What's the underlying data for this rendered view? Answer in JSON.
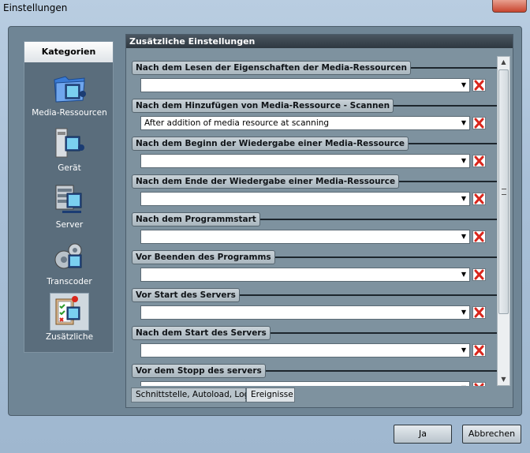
{
  "window": {
    "title": "Einstellungen"
  },
  "sidebar": {
    "header": "Kategorien",
    "items": [
      {
        "label": "Media-Ressourcen",
        "icon": "media-resources-icon"
      },
      {
        "label": "Gerät",
        "icon": "device-icon"
      },
      {
        "label": "Server",
        "icon": "server-icon"
      },
      {
        "label": "Transcoder",
        "icon": "transcoder-icon"
      },
      {
        "label": "Zusätzliche",
        "icon": "additional-icon"
      }
    ]
  },
  "main": {
    "header": "Zusätzliche Einstellungen",
    "groups": [
      {
        "title": "Nach dem Lesen der Eigenschaften der Media-Ressourcen",
        "value": ""
      },
      {
        "title": "Nach dem Hinzufügen von Media-Ressource - Scannen",
        "value": "After addition of media resource at scanning"
      },
      {
        "title": "Nach dem Beginn der Wiedergabe einer Media-Ressource",
        "value": ""
      },
      {
        "title": "Nach dem Ende der Wiedergabe einer Media-Ressource",
        "value": ""
      },
      {
        "title": "Nach dem Programmstart",
        "value": ""
      },
      {
        "title": "Vor Beenden des Programms",
        "value": ""
      },
      {
        "title": "Vor Start des Servers",
        "value": ""
      },
      {
        "title": "Nach dem Start des Servers",
        "value": ""
      },
      {
        "title": "Vor dem Stopp des servers",
        "value": ""
      }
    ],
    "tabs": [
      {
        "label": "Schnittstelle, Autoload, Log"
      },
      {
        "label": "Ereignisse"
      }
    ]
  },
  "buttons": {
    "ok": "Ja",
    "cancel": "Abbrechen"
  },
  "colors": {
    "accent_red": "#d9261c",
    "header_dark": "#2e3840",
    "panel": "#7e929f"
  }
}
